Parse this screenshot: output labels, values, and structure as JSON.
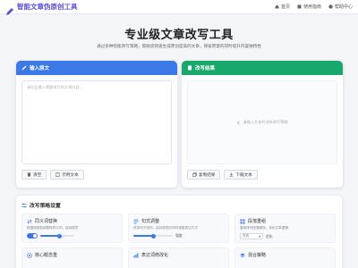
{
  "brand": {
    "title": "智能文章伪原创工具",
    "icon": "pen-icon",
    "color": "#5b4fd6"
  },
  "nav": [
    {
      "label": "首页",
      "icon": "home-icon"
    },
    {
      "label": "使用指南",
      "icon": "book-icon"
    },
    {
      "label": "帮助中心",
      "icon": "help-icon"
    }
  ],
  "hero": {
    "title": "专业级文章改写工具",
    "subtitle": "通过多种智能改写策略，帮助您快速生成原创度高的文章，保留原意的同时提升内容独特性"
  },
  "input_panel": {
    "title": "输入原文",
    "placeholder": "请在此输入需要改写的文章内容...",
    "buttons": {
      "clear": "清空",
      "example": "示例文本"
    },
    "color": "#3b7ae6"
  },
  "output_panel": {
    "title": "改写结果",
    "empty_text": "请输入文本并选择改写策略",
    "buttons": {
      "copy": "复制结果",
      "download": "下载文本"
    },
    "color": "#18a86b"
  },
  "strategy": {
    "title": "改写策略设置",
    "cards": [
      {
        "title": "同义词替换",
        "icon": "swap-icon",
        "desc": "根据语境智能替换同义词，保持原意",
        "control": "toggle",
        "control_label": ""
      },
      {
        "title": "句式调整",
        "icon": "list-icon",
        "desc": "改变句子结构，保持原意的同时调整表达方式",
        "control": "slider",
        "control_label": "强度",
        "level": 0.5
      },
      {
        "title": "段落重组",
        "icon": "grid-icon",
        "desc": "重新排列段落顺序，优化文章逻辑",
        "control": "select",
        "control_label": "方式",
        "selected": "优化"
      },
      {
        "title": "核心概念重",
        "icon": "target-icon",
        "desc": "",
        "control": "",
        "control_label": ""
      },
      {
        "title": "表达词修改化",
        "icon": "chart-icon",
        "desc": "",
        "control": "",
        "control_label": ""
      },
      {
        "title": "混合策略",
        "icon": "layers-icon",
        "desc": "",
        "control": "",
        "control_label": ""
      }
    ]
  }
}
